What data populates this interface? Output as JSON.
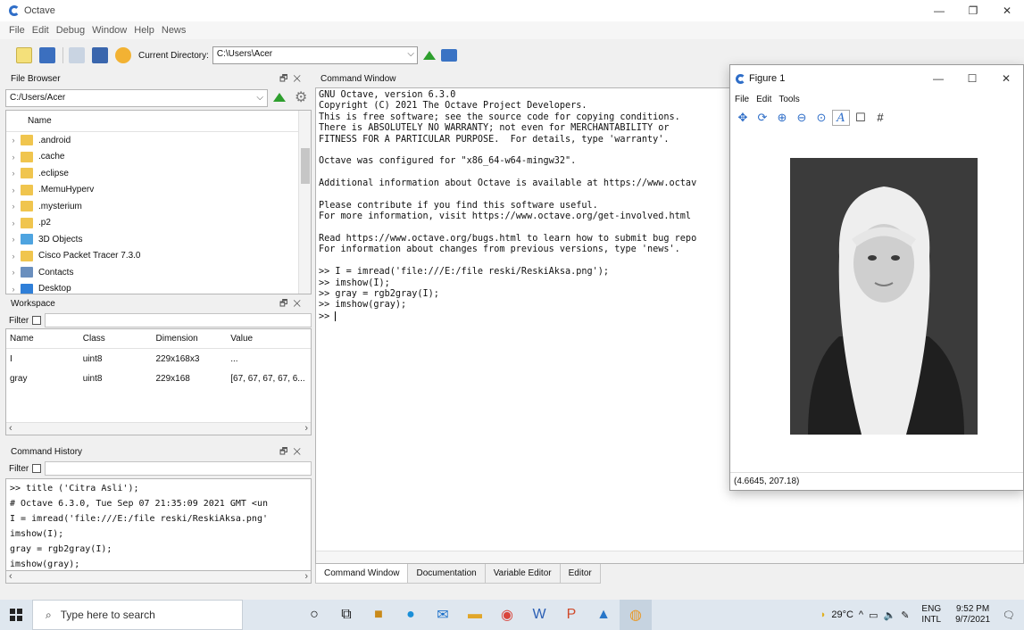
{
  "window": {
    "title": "Octave"
  },
  "menu": [
    "File",
    "Edit",
    "Debug",
    "Window",
    "Help",
    "News"
  ],
  "toolbar": {
    "cd_label": "Current Directory:",
    "cd_value": "C:\\Users\\Acer"
  },
  "file_browser": {
    "title": "File Browser",
    "path": "C:/Users/Acer",
    "column": "Name",
    "items": [
      ".android",
      ".cache",
      ".eclipse",
      ".MemuHyperv",
      ".mysterium",
      ".p2",
      "3D Objects",
      "Cisco Packet Tracer 7.3.0",
      "Contacts",
      "Desktop"
    ]
  },
  "workspace": {
    "title": "Workspace",
    "filter_label": "Filter",
    "headers": [
      "Name",
      "Class",
      "Dimension",
      "Value"
    ],
    "rows": [
      [
        "I",
        "uint8",
        "229x168x3",
        "..."
      ],
      [
        "gray",
        "uint8",
        "229x168",
        "[67, 67, 67, 67, 6..."
      ]
    ]
  },
  "history": {
    "title": "Command History",
    "filter_label": "Filter",
    "lines": [
      ">> title ('Citra Asli');",
      "# Octave 6.3.0, Tue Sep 07 21:35:09 2021 GMT <un",
      "I = imread('file:///E:/file reski/ReskiAksa.png'",
      "imshow(I);",
      "gray = rgb2gray(I);",
      "imshow(gray);"
    ]
  },
  "command_window": {
    "title": "Command Window",
    "lines": [
      "GNU Octave, version 6.3.0",
      "Copyright (C) 2021 The Octave Project Developers.",
      "This is free software; see the source code for copying conditions.",
      "There is ABSOLUTELY NO WARRANTY; not even for MERCHANTABILITY or",
      "FITNESS FOR A PARTICULAR PURPOSE.  For details, type 'warranty'.",
      "",
      "Octave was configured for \"x86_64-w64-mingw32\".",
      "",
      "Additional information about Octave is available at https://www.octav",
      "",
      "Please contribute if you find this software useful.",
      "For more information, visit https://www.octave.org/get-involved.html",
      "",
      "Read https://www.octave.org/bugs.html to learn how to submit bug repo",
      "For information about changes from previous versions, type 'news'.",
      "",
      ">> I = imread('file:///E:/file reski/ReskiAksa.png');",
      ">> imshow(I);",
      ">> gray = rgb2gray(I);",
      ">> imshow(gray);"
    ],
    "prompt": ">> ",
    "tabs": [
      "Command Window",
      "Documentation",
      "Variable Editor",
      "Editor"
    ]
  },
  "figure": {
    "title": "Figure 1",
    "menu": [
      "File",
      "Edit",
      "Tools"
    ],
    "status": "(4.6645, 207.18)"
  },
  "taskbar": {
    "search_placeholder": "Type here to search",
    "weather": "29°C",
    "lang_top": "ENG",
    "lang_bottom": "INTL",
    "time": "9:52 PM",
    "date": "9/7/2021"
  }
}
